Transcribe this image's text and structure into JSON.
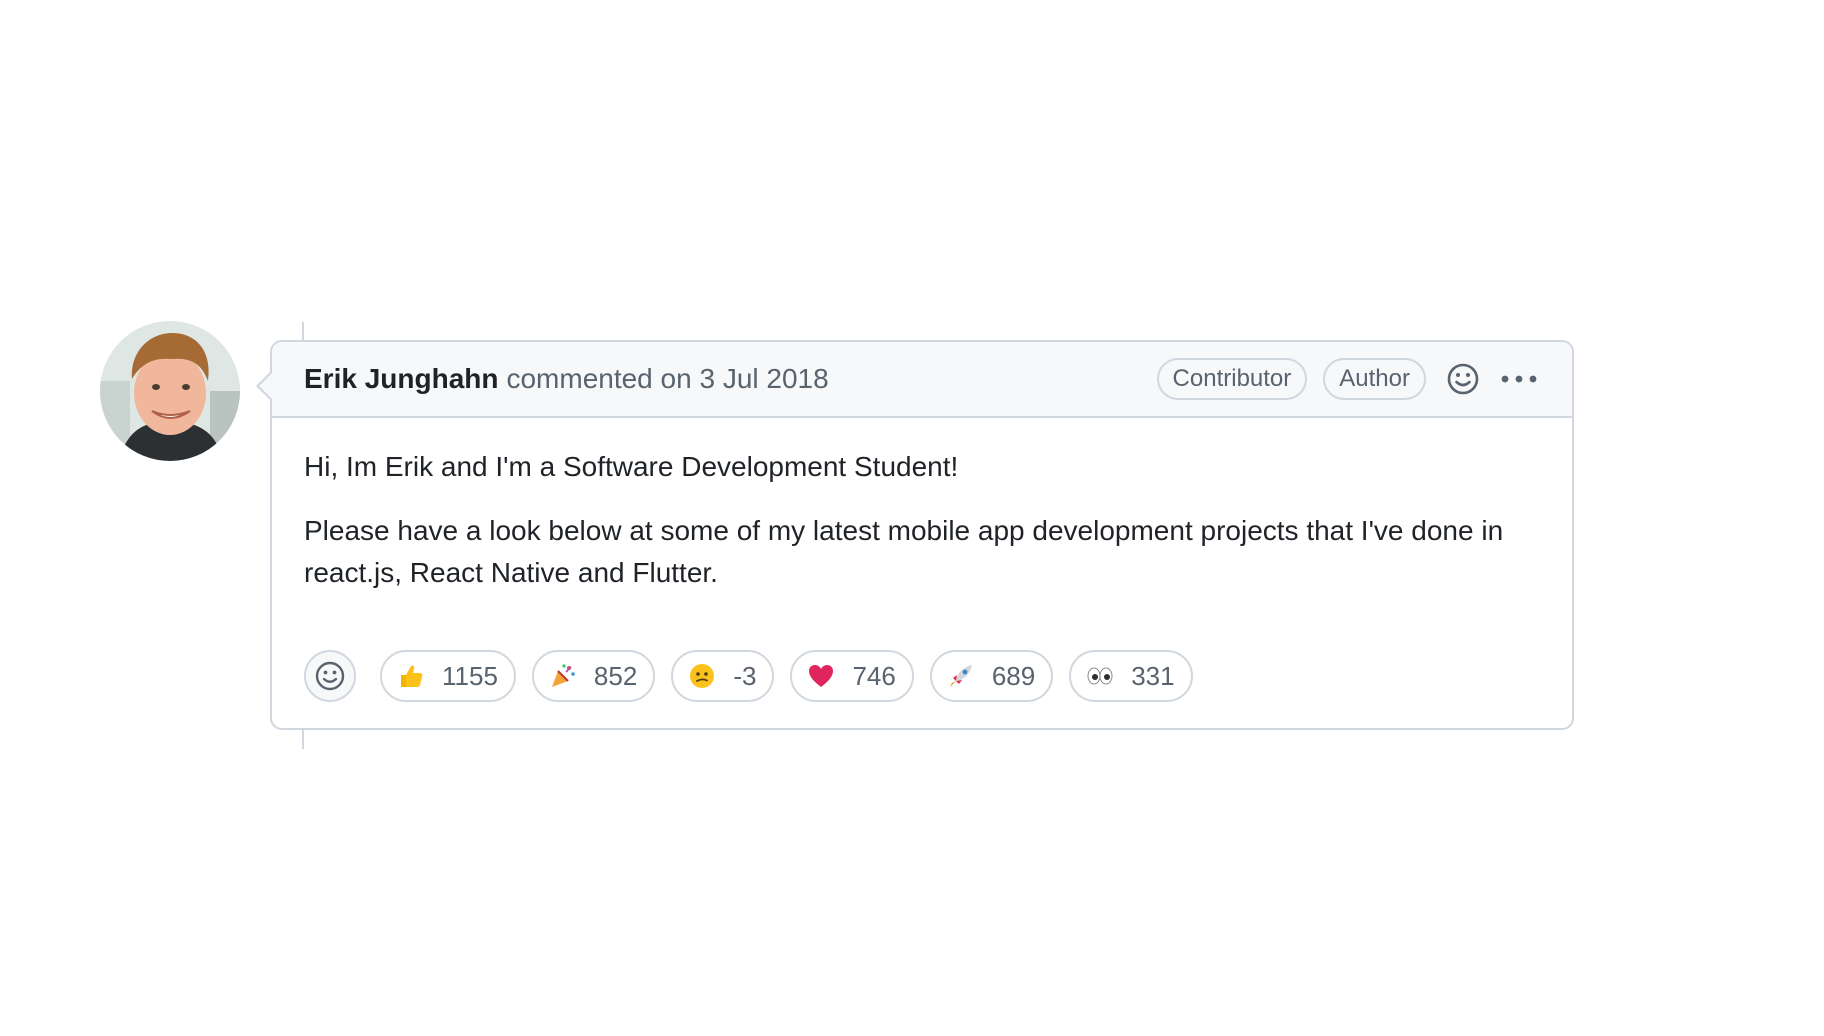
{
  "comment": {
    "author": "Erik Junghahn",
    "meta": "commented on 3 Jul 2018",
    "badges": [
      "Contributor",
      "Author"
    ],
    "body": [
      "Hi, Im Erik and I'm a Software Development Student!",
      "Please have a look below at some of my latest mobile app development projects that I've done in react.js, React Native and Flutter."
    ]
  },
  "reactions": [
    {
      "emoji": "thumbs-up",
      "count": "1155"
    },
    {
      "emoji": "tada",
      "count": "852"
    },
    {
      "emoji": "confused",
      "count": "-3"
    },
    {
      "emoji": "heart",
      "count": "746"
    },
    {
      "emoji": "rocket",
      "count": "689"
    },
    {
      "emoji": "eyes",
      "count": "331"
    }
  ],
  "icons": {
    "add_reaction": "smiley-icon",
    "header_reaction": "smiley-icon",
    "more": "kebab-horizontal-icon"
  },
  "colors": {
    "border": "#d0d7de",
    "header_bg": "#f6f8fa",
    "muted_text": "#59636e",
    "text": "#1f2328"
  }
}
